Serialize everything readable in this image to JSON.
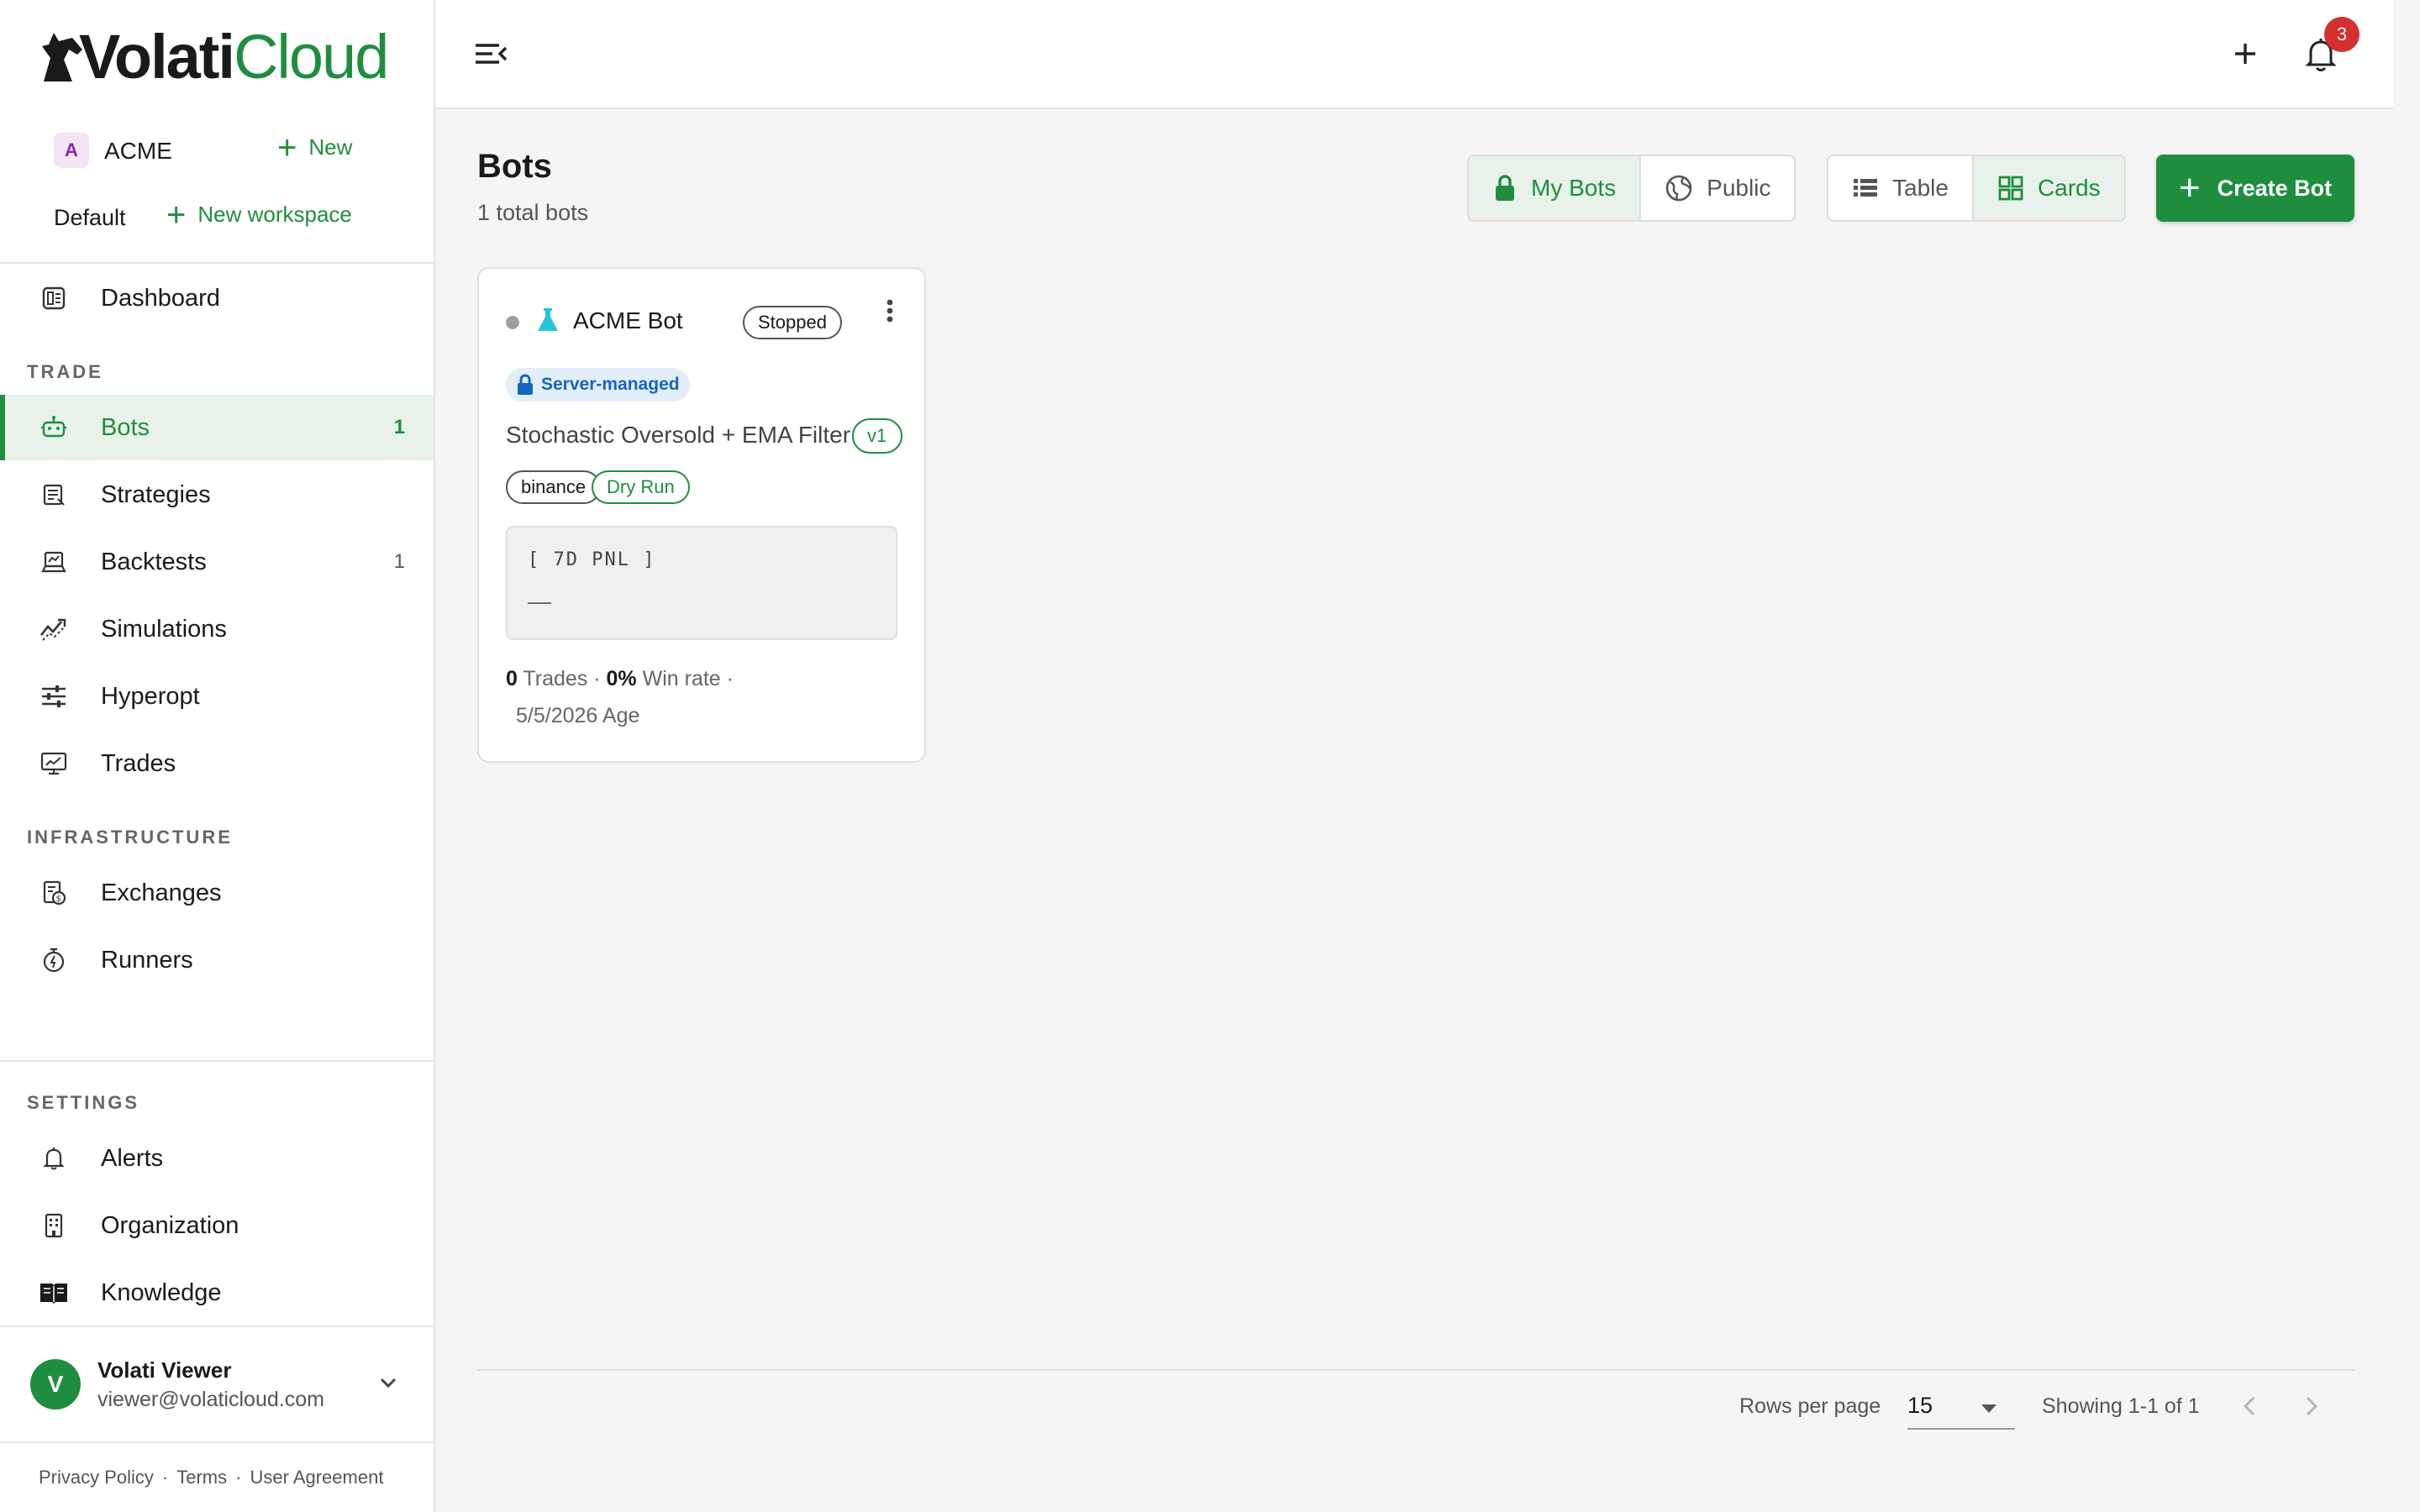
{
  "brand": {
    "logo_part1": "Volati",
    "logo_part2": "Cloud"
  },
  "org": {
    "avatar_letter": "A",
    "name": "ACME",
    "new_label": "New"
  },
  "workspace": {
    "name": "Default",
    "new_label": "New workspace"
  },
  "nav": {
    "dashboard": "Dashboard",
    "trade_section": "TRADE",
    "trade": [
      {
        "label": "Bots",
        "count": "1",
        "icon": "robot-icon",
        "active": true
      },
      {
        "label": "Strategies",
        "count": "",
        "icon": "strategy-icon"
      },
      {
        "label": "Backtests",
        "count": "1",
        "icon": "backtest-icon"
      },
      {
        "label": "Simulations",
        "count": "",
        "icon": "simulation-icon"
      },
      {
        "label": "Hyperopt",
        "count": "",
        "icon": "sliders-icon"
      },
      {
        "label": "Trades",
        "count": "",
        "icon": "monitor-chart-icon"
      }
    ],
    "infra_section": "INFRASTRUCTURE",
    "infra": [
      {
        "label": "Exchanges",
        "icon": "exchange-icon"
      },
      {
        "label": "Runners",
        "icon": "stopwatch-icon"
      }
    ],
    "settings_section": "SETTINGS",
    "settings": [
      {
        "label": "Alerts",
        "icon": "bell-icon"
      },
      {
        "label": "Organization",
        "icon": "building-icon"
      },
      {
        "label": "Knowledge",
        "icon": "book-icon"
      }
    ]
  },
  "user": {
    "avatar_letter": "V",
    "name": "Volati Viewer",
    "email": "viewer@volaticloud.com"
  },
  "footer": {
    "privacy": "Privacy Policy",
    "sep": "·",
    "terms": "Terms",
    "agreement": "User Agreement"
  },
  "topbar": {
    "notification_count": "3"
  },
  "page": {
    "title": "Bots",
    "subtitle": "1 total bots",
    "filter": {
      "mine": "My Bots",
      "public": "Public",
      "selected": "My Bots"
    },
    "view": {
      "table": "Table",
      "cards": "Cards",
      "selected": "Cards"
    },
    "create_label": "Create Bot"
  },
  "bots": [
    {
      "name": "ACME Bot",
      "status": "Stopped",
      "managed": "Server-managed",
      "strategy": "Stochastic Oversold + EMA Filter",
      "version": "v1",
      "exchange": "binance",
      "mode": "Dry Run",
      "pnl_label": "[ 7D PNL ]",
      "pnl_value": "—",
      "trades": "0",
      "trades_label": "Trades",
      "win_rate": "0%",
      "win_rate_label": "Win rate",
      "age": "5/5/2026",
      "age_label": "Age",
      "dot": "·"
    }
  ],
  "pagination": {
    "rows_label": "Rows per page",
    "rows_value": "15",
    "showing": "Showing 1-1 of 1"
  },
  "colors": {
    "accent": "#1e8e3e",
    "badge": "#d32f2f",
    "managed": "#1565c0"
  }
}
